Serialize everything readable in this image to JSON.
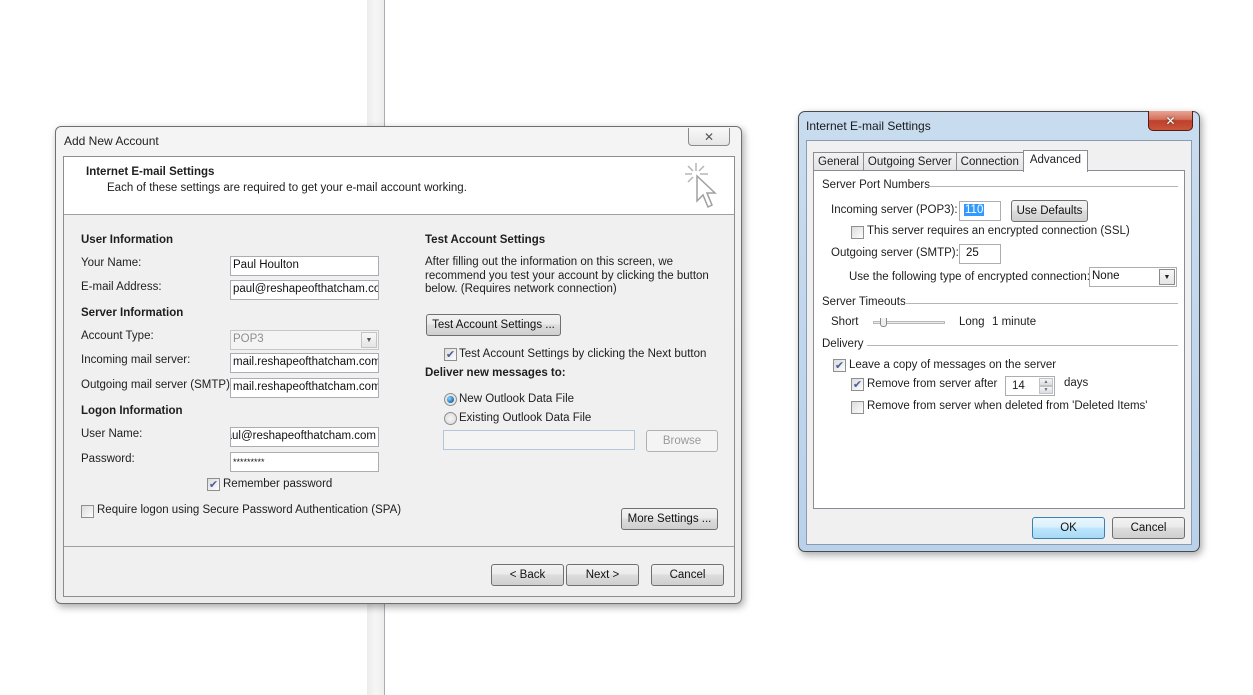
{
  "add_account": {
    "title": "Add New Account",
    "header": {
      "title": "Internet E-mail Settings",
      "subtitle": "Each of these settings are required to get your e-mail account working."
    },
    "user_info": {
      "heading": "User Information",
      "name_label": "Your Name:",
      "name_value": "Paul Houlton",
      "email_label": "E-mail Address:",
      "email_value": "paul@reshapeofthatcham.com"
    },
    "server_info": {
      "heading": "Server Information",
      "account_type_label": "Account Type:",
      "account_type_value": "POP3",
      "incoming_label": "Incoming mail server:",
      "incoming_value": "mail.reshapeofthatcham.com",
      "outgoing_label": "Outgoing mail server (SMTP):",
      "outgoing_value": "mail.reshapeofthatcham.com"
    },
    "logon_info": {
      "heading": "Logon Information",
      "username_label": "User Name:",
      "username_value": "paul@reshapeofthatcham.com",
      "password_label": "Password:",
      "password_value": "*********",
      "remember_label": "Remember password",
      "remember_checked": true,
      "spa_label": "Require logon using Secure Password Authentication (SPA)",
      "spa_checked": false
    },
    "test": {
      "heading": "Test Account Settings",
      "description_1": "After filling out the information on this screen, we",
      "description_2": "recommend you test your account by clicking the button",
      "description_3": "below. (Requires network connection)",
      "button": "Test Account Settings ...",
      "next_check_label": "Test Account Settings by clicking the Next button",
      "next_check_checked": true
    },
    "deliver": {
      "heading": "Deliver new messages to:",
      "option_new": "New Outlook Data File",
      "option_existing": "Existing Outlook Data File",
      "selected": "New Outlook Data File",
      "file_value": "",
      "browse": "Browse"
    },
    "more_settings": "More Settings ...",
    "footer": {
      "back": "< Back",
      "next": "Next >",
      "cancel": "Cancel"
    }
  },
  "email_settings": {
    "title": "Internet E-mail Settings",
    "tabs": [
      "General",
      "Outgoing Server",
      "Connection",
      "Advanced"
    ],
    "active_tab": "Advanced",
    "ports": {
      "heading": "Server Port Numbers",
      "incoming_label": "Incoming server (POP3):",
      "incoming_value": "110",
      "use_defaults": "Use Defaults",
      "ssl_label": "This server requires an encrypted connection (SSL)",
      "ssl_checked": false,
      "outgoing_label": "Outgoing server (SMTP):",
      "outgoing_value": "25",
      "encryption_label": "Use the following type of encrypted connection:",
      "encryption_value": "None"
    },
    "timeouts": {
      "heading": "Server Timeouts",
      "short": "Short",
      "long": "Long",
      "value": "1 minute",
      "slider_fraction": 0.1
    },
    "delivery": {
      "heading": "Delivery",
      "leave_copy_label": "Leave a copy of messages on the server",
      "leave_copy_checked": true,
      "remove_after_label": "Remove from server after",
      "remove_after_checked": true,
      "remove_after_days": "14",
      "days_label": "days",
      "remove_deleted_label": "Remove from server when deleted from 'Deleted Items'",
      "remove_deleted_checked": false
    },
    "ok": "OK",
    "cancel": "Cancel"
  }
}
